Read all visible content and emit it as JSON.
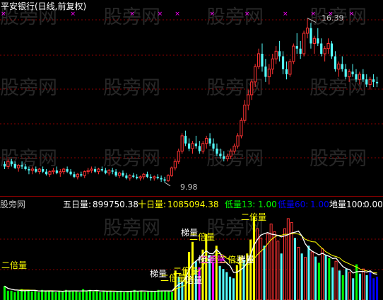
{
  "upper": {
    "title": "平安银行(日线,前复权)",
    "price_high_label": "16.39",
    "price_low_label": "9.98",
    "colors": {
      "up": "#ff3232",
      "down": "#54ffff",
      "grid": "#8b0000",
      "marker": "#ff00ff",
      "title": "#ffffff"
    }
  },
  "lower": {
    "watermark_label": "股旁网",
    "indicators": [
      {
        "label": "五日量:",
        "value": "899750.38",
        "color": "#ffffff"
      },
      {
        "label": "十日量:",
        "value": "1085094.38",
        "color": "#ffff00"
      },
      {
        "label": "低量13:",
        "value": "1.00",
        "color": "#00ff00"
      },
      {
        "label": "低量60:",
        "value": "1.00",
        "color": "#0000ff"
      },
      {
        "label": "地量100:",
        "value": "0.00",
        "color": "#ffffff"
      }
    ],
    "annotations": [
      {
        "text": "二倍量",
        "color": "#ffff00"
      },
      {
        "text": "梯量",
        "color": "#ffffff"
      },
      {
        "text": "二倍量",
        "color": "#ffff00"
      },
      {
        "text": "梯量",
        "color": "#ffffff"
      },
      {
        "text": "二倍量",
        "color": "#ffff00"
      },
      {
        "text": "二倍量",
        "color": "#ffff00"
      },
      {
        "text": "倍量",
        "color": "#ffffff"
      },
      {
        "text": "梯量",
        "color": "#ffffff"
      },
      {
        "text": "二倍量",
        "color": "#ffff00"
      },
      {
        "text": "二倍量",
        "color": "#ffff00"
      },
      {
        "text": "梯量",
        "color": "#ffffff"
      },
      {
        "text": "二倍量",
        "color": "#ffff00"
      }
    ]
  },
  "watermarks": [
    "股旁网",
    "股旁网",
    "股旁网",
    "股旁网",
    "股旁网",
    "股旁网",
    "股旁网",
    "股旁网",
    "股旁网",
    "股旁网",
    "股旁网",
    "股旁网",
    "股旁网",
    "股旁网"
  ],
  "chart_data": [
    {
      "type": "candlestick",
      "title": "平安银行(日线,前复权)",
      "annotated_high": 16.39,
      "annotated_low": 9.98,
      "ohlc": [
        [
          10.7,
          10.8,
          10.5,
          10.6
        ],
        [
          10.6,
          10.9,
          10.5,
          10.8
        ],
        [
          10.8,
          10.9,
          10.6,
          10.7
        ],
        [
          10.7,
          10.8,
          10.5,
          10.55
        ],
        [
          10.55,
          10.7,
          10.4,
          10.65
        ],
        [
          10.65,
          10.8,
          10.5,
          10.6
        ],
        [
          10.6,
          10.7,
          10.45,
          10.5
        ],
        [
          10.5,
          10.6,
          10.3,
          10.45
        ],
        [
          10.45,
          10.6,
          10.3,
          10.5
        ],
        [
          10.5,
          10.6,
          10.35,
          10.4
        ],
        [
          10.4,
          10.55,
          10.3,
          10.5
        ],
        [
          10.5,
          10.6,
          10.35,
          10.4
        ],
        [
          10.4,
          10.5,
          10.25,
          10.3
        ],
        [
          10.3,
          10.45,
          10.2,
          10.4
        ],
        [
          10.4,
          10.55,
          10.3,
          10.45
        ],
        [
          10.45,
          10.6,
          10.3,
          10.35
        ],
        [
          10.35,
          10.5,
          10.2,
          10.4
        ],
        [
          10.4,
          10.55,
          10.3,
          10.5
        ],
        [
          10.5,
          10.6,
          10.35,
          10.4
        ],
        [
          10.4,
          10.5,
          10.25,
          10.3
        ],
        [
          10.3,
          10.4,
          10.15,
          10.2
        ],
        [
          10.2,
          10.35,
          10.1,
          10.3
        ],
        [
          10.3,
          10.4,
          10.2,
          10.25
        ],
        [
          10.25,
          10.45,
          10.15,
          10.4
        ],
        [
          10.4,
          10.55,
          10.3,
          10.45
        ],
        [
          10.45,
          10.6,
          10.35,
          10.5
        ],
        [
          10.5,
          10.6,
          10.35,
          10.4
        ],
        [
          10.4,
          10.55,
          10.3,
          10.5
        ],
        [
          10.5,
          10.6,
          10.4,
          10.45
        ],
        [
          10.45,
          10.55,
          10.3,
          10.35
        ],
        [
          10.35,
          10.5,
          10.25,
          10.45
        ],
        [
          10.45,
          10.55,
          10.3,
          10.4
        ],
        [
          10.4,
          10.5,
          10.2,
          10.25
        ],
        [
          10.25,
          10.4,
          10.15,
          10.35
        ],
        [
          10.35,
          10.45,
          10.2,
          10.25
        ],
        [
          10.25,
          10.35,
          10.1,
          10.15
        ],
        [
          10.15,
          10.3,
          10.05,
          10.25
        ],
        [
          10.25,
          10.35,
          10.15,
          10.2
        ],
        [
          10.2,
          10.3,
          10.1,
          10.15
        ],
        [
          10.15,
          10.25,
          10.05,
          10.2
        ],
        [
          10.2,
          10.35,
          10.1,
          10.3
        ],
        [
          10.3,
          10.4,
          10.15,
          10.2
        ],
        [
          10.2,
          10.3,
          10.05,
          10.15
        ],
        [
          10.15,
          10.25,
          10.05,
          10.2
        ],
        [
          10.2,
          10.3,
          10.1,
          10.15
        ],
        [
          10.15,
          10.25,
          10.0,
          10.1
        ],
        [
          10.1,
          10.2,
          9.98,
          10.05
        ],
        [
          10.05,
          10.3,
          10.0,
          10.25
        ],
        [
          10.25,
          10.6,
          10.2,
          10.55
        ],
        [
          10.55,
          10.9,
          10.45,
          10.8
        ],
        [
          10.8,
          11.3,
          10.7,
          11.2
        ],
        [
          11.2,
          11.9,
          11.1,
          11.8
        ],
        [
          11.8,
          12.0,
          11.4,
          11.5
        ],
        [
          11.5,
          11.7,
          11.2,
          11.3
        ],
        [
          11.3,
          11.6,
          11.1,
          11.5
        ],
        [
          11.5,
          11.8,
          11.3,
          11.4
        ],
        [
          11.4,
          11.6,
          11.1,
          11.2
        ],
        [
          11.2,
          11.6,
          11.1,
          11.5
        ],
        [
          11.5,
          11.8,
          11.3,
          11.7
        ],
        [
          11.7,
          11.9,
          11.4,
          11.5
        ],
        [
          11.5,
          11.7,
          11.2,
          11.3
        ],
        [
          11.3,
          11.5,
          11.0,
          11.1
        ],
        [
          11.1,
          11.3,
          10.9,
          11.0
        ],
        [
          11.0,
          11.2,
          10.8,
          10.9
        ],
        [
          10.9,
          11.1,
          10.8,
          11.0
        ],
        [
          11.0,
          11.3,
          10.9,
          11.2
        ],
        [
          11.2,
          11.5,
          11.1,
          11.4
        ],
        [
          11.4,
          11.9,
          11.3,
          11.8
        ],
        [
          11.8,
          12.5,
          11.7,
          12.4
        ],
        [
          12.4,
          13.2,
          12.3,
          13.0
        ],
        [
          13.0,
          13.6,
          12.8,
          13.4
        ],
        [
          13.4,
          14.0,
          13.2,
          13.9
        ],
        [
          13.9,
          14.6,
          13.7,
          14.5
        ],
        [
          14.5,
          15.2,
          14.4,
          15.0
        ],
        [
          15.0,
          15.4,
          14.3,
          14.5
        ],
        [
          14.5,
          14.8,
          13.9,
          14.1
        ],
        [
          14.1,
          14.6,
          13.8,
          14.4
        ],
        [
          14.4,
          15.0,
          14.2,
          14.8
        ],
        [
          14.8,
          15.3,
          14.6,
          15.1
        ],
        [
          15.1,
          15.5,
          14.7,
          14.9
        ],
        [
          14.9,
          15.1,
          14.2,
          14.4
        ],
        [
          14.4,
          14.7,
          14.0,
          14.2
        ],
        [
          14.2,
          14.8,
          14.1,
          14.7
        ],
        [
          14.7,
          15.4,
          14.6,
          15.3
        ],
        [
          15.3,
          15.8,
          15.0,
          15.2
        ],
        [
          15.2,
          15.5,
          14.8,
          15.0
        ],
        [
          15.0,
          15.9,
          14.9,
          15.8
        ],
        [
          15.8,
          16.39,
          15.6,
          16.0
        ],
        [
          16.0,
          16.2,
          15.2,
          15.4
        ],
        [
          15.4,
          15.7,
          15.0,
          15.6
        ],
        [
          15.6,
          16.0,
          15.3,
          15.4
        ],
        [
          15.4,
          15.6,
          14.9,
          15.0
        ],
        [
          15.0,
          15.3,
          14.7,
          15.2
        ],
        [
          15.2,
          15.6,
          15.0,
          15.4
        ],
        [
          15.4,
          15.5,
          14.8,
          14.9
        ],
        [
          14.9,
          15.1,
          14.3,
          14.4
        ],
        [
          14.4,
          14.7,
          14.1,
          14.6
        ],
        [
          14.6,
          14.9,
          14.3,
          14.4
        ],
        [
          14.4,
          14.6,
          14.0,
          14.1
        ],
        [
          14.1,
          14.4,
          13.9,
          14.3
        ],
        [
          14.3,
          14.6,
          14.1,
          14.2
        ],
        [
          14.2,
          14.4,
          13.9,
          14.0
        ],
        [
          14.0,
          14.3,
          13.8,
          14.2
        ],
        [
          14.2,
          14.4,
          13.9,
          14.0
        ],
        [
          14.0,
          14.2,
          13.7,
          13.8
        ],
        [
          13.8,
          14.1,
          13.6,
          14.0
        ],
        [
          14.0,
          14.2,
          13.7,
          13.9
        ],
        [
          13.9,
          14.1,
          13.7,
          13.85
        ]
      ]
    },
    {
      "type": "bar",
      "series_labels": [
        "五日量",
        "十日量"
      ],
      "latest": {
        "五日量": 899750.38,
        "十日量": 1085094.38,
        "低量13": 1.0,
        "低量60": 1.0,
        "地量100": 0.0
      },
      "volumes": [
        18,
        12,
        12,
        10,
        12,
        14,
        12,
        13,
        11,
        12,
        10,
        13,
        12,
        11,
        12,
        10,
        12,
        11,
        13,
        12,
        11,
        12,
        10,
        14,
        12,
        13,
        11,
        12,
        10,
        12,
        11,
        12,
        10,
        11,
        12,
        10,
        11,
        12,
        13,
        11,
        12,
        10,
        11,
        12,
        11,
        13,
        12,
        11,
        12,
        10,
        38,
        30,
        24,
        40,
        62,
        75,
        50,
        42,
        65,
        85,
        58,
        48,
        70,
        44,
        40,
        36,
        30,
        28,
        45,
        55,
        52,
        60,
        78,
        108,
        92,
        80,
        70,
        85,
        98,
        88,
        76,
        60,
        92,
        105,
        100,
        80,
        68,
        60,
        55,
        70,
        62,
        56,
        48,
        66,
        58,
        54,
        42,
        50,
        38,
        32,
        40,
        36,
        28,
        46,
        34,
        40,
        32,
        36,
        28,
        30
      ],
      "vol_colors": [
        "g",
        "g",
        "g",
        "g",
        "g",
        "g",
        "g",
        "g",
        "g",
        "g",
        "g",
        "g",
        "g",
        "g",
        "g",
        "g",
        "g",
        "g",
        "g",
        "g",
        "g",
        "g",
        "g",
        "g",
        "g",
        "g",
        "g",
        "g",
        "g",
        "g",
        "g",
        "g",
        "g",
        "g",
        "g",
        "g",
        "g",
        "g",
        "g",
        "g",
        "g",
        "g",
        "g",
        "g",
        "g",
        "g",
        "g",
        "g",
        "g",
        "g",
        "y",
        "c",
        "c",
        "y",
        "y",
        "y",
        "c",
        "m",
        "y",
        "y",
        "c",
        "m",
        "y",
        "c",
        "c",
        "c",
        "c",
        "c",
        "y",
        "y",
        "c",
        "y",
        "y",
        "y",
        "r",
        "r",
        "c",
        "r",
        "r",
        "r",
        "r",
        "c",
        "r",
        "r",
        "r",
        "c",
        "r",
        "c",
        "r",
        "c",
        "r",
        "c",
        "g",
        "r",
        "c",
        "g",
        "c",
        "r",
        "c",
        "g",
        "c",
        "r",
        "c",
        "g",
        "c",
        "r",
        "c",
        "b",
        "b",
        "b"
      ]
    }
  ]
}
